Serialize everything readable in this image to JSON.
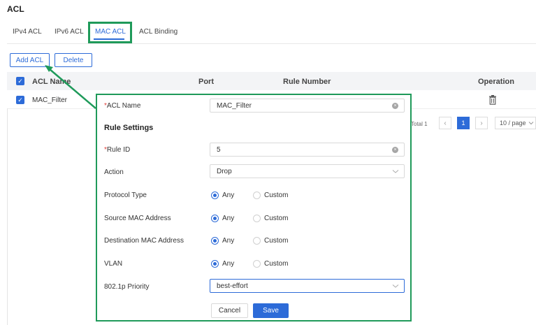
{
  "page": {
    "title": "ACL"
  },
  "tabs": [
    {
      "label": "IPv4 ACL",
      "active": false
    },
    {
      "label": "IPv6 ACL",
      "active": false
    },
    {
      "label": "MAC ACL",
      "active": true
    },
    {
      "label": "ACL Binding",
      "active": false
    }
  ],
  "toolbar": {
    "add_label": "Add ACL",
    "delete_label": "Delete"
  },
  "table": {
    "columns": [
      "ACL Name",
      "Port",
      "Rule Number",
      "Operation"
    ],
    "rows": [
      {
        "name": "MAC_Filter",
        "checked": true
      }
    ],
    "select_all_checked": true
  },
  "pagination": {
    "total": "Total 1",
    "current_page": "1",
    "page_size": "10 / page"
  },
  "form": {
    "acl_name": {
      "label": "ACL Name",
      "value": "MAC_Filter",
      "required": true
    },
    "section_title": "Rule Settings",
    "rule_id": {
      "label": "Rule ID",
      "value": "5",
      "required": true
    },
    "action": {
      "label": "Action",
      "value": "Drop"
    },
    "protocol_type": {
      "label": "Protocol Type",
      "options": [
        "Any",
        "Custom"
      ],
      "selected": "Any"
    },
    "source_mac": {
      "label": "Source MAC Address",
      "options": [
        "Any",
        "Custom"
      ],
      "selected": "Any"
    },
    "dest_mac": {
      "label": "Destination MAC Address",
      "options": [
        "Any",
        "Custom"
      ],
      "selected": "Any"
    },
    "vlan": {
      "label": "VLAN",
      "options": [
        "Any",
        "Custom"
      ],
      "selected": "Any"
    },
    "priority": {
      "label": "802.1p Priority",
      "value": "best-effort"
    },
    "cancel_label": "Cancel",
    "save_label": "Save"
  },
  "colors": {
    "accent": "#2d6bd8",
    "annotation": "#1f9a5a",
    "required": "#e0403a"
  }
}
